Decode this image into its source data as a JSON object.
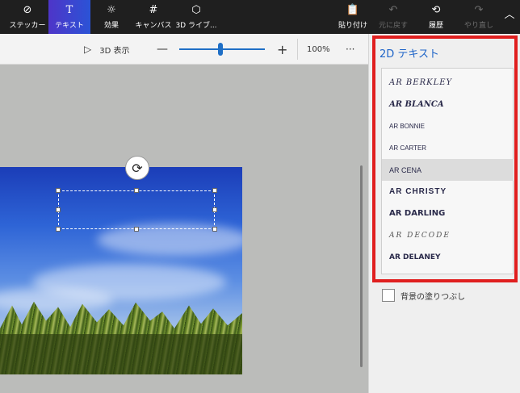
{
  "ribbon": {
    "sticker": {
      "label": "ステッカー",
      "icon": "sticker-icon"
    },
    "text": {
      "label": "テキスト",
      "icon": "text-tool-icon"
    },
    "effects": {
      "label": "効果",
      "icon": "effects-icon"
    },
    "canvas": {
      "label": "キャンバス",
      "icon": "canvas-icon"
    },
    "library3d": {
      "label": "3D ライブ...",
      "icon": "3d-library-icon"
    },
    "paste": {
      "label": "貼り付け",
      "icon": "paste-icon"
    },
    "undo": {
      "label": "元に戻す",
      "icon": "undo-icon"
    },
    "history": {
      "label": "履歴",
      "icon": "history-icon"
    },
    "redo": {
      "label": "やり直し",
      "icon": "redo-icon"
    },
    "active_color": "#3f44cf"
  },
  "subbar": {
    "view3d_label": "3D 表示",
    "zoom_minus": "—",
    "zoom_plus": "+",
    "zoom_level": "100%",
    "zoom_fraction": 0.5,
    "more": "···"
  },
  "panel": {
    "title": "2D テキスト",
    "fonts": [
      "AR BERKLEY",
      "AR BLANCA",
      "AR BONNIE",
      "AR CARTER",
      "AR CENA",
      "AR CHRISTY",
      "AR DARLING",
      "AR DECODE",
      "AR DELANEY"
    ],
    "selected_font": "AR CENA",
    "fill_background_label": "背景の塗りつぶし",
    "title_color": "#1e64c8",
    "highlight_color": "#e01f1f"
  }
}
